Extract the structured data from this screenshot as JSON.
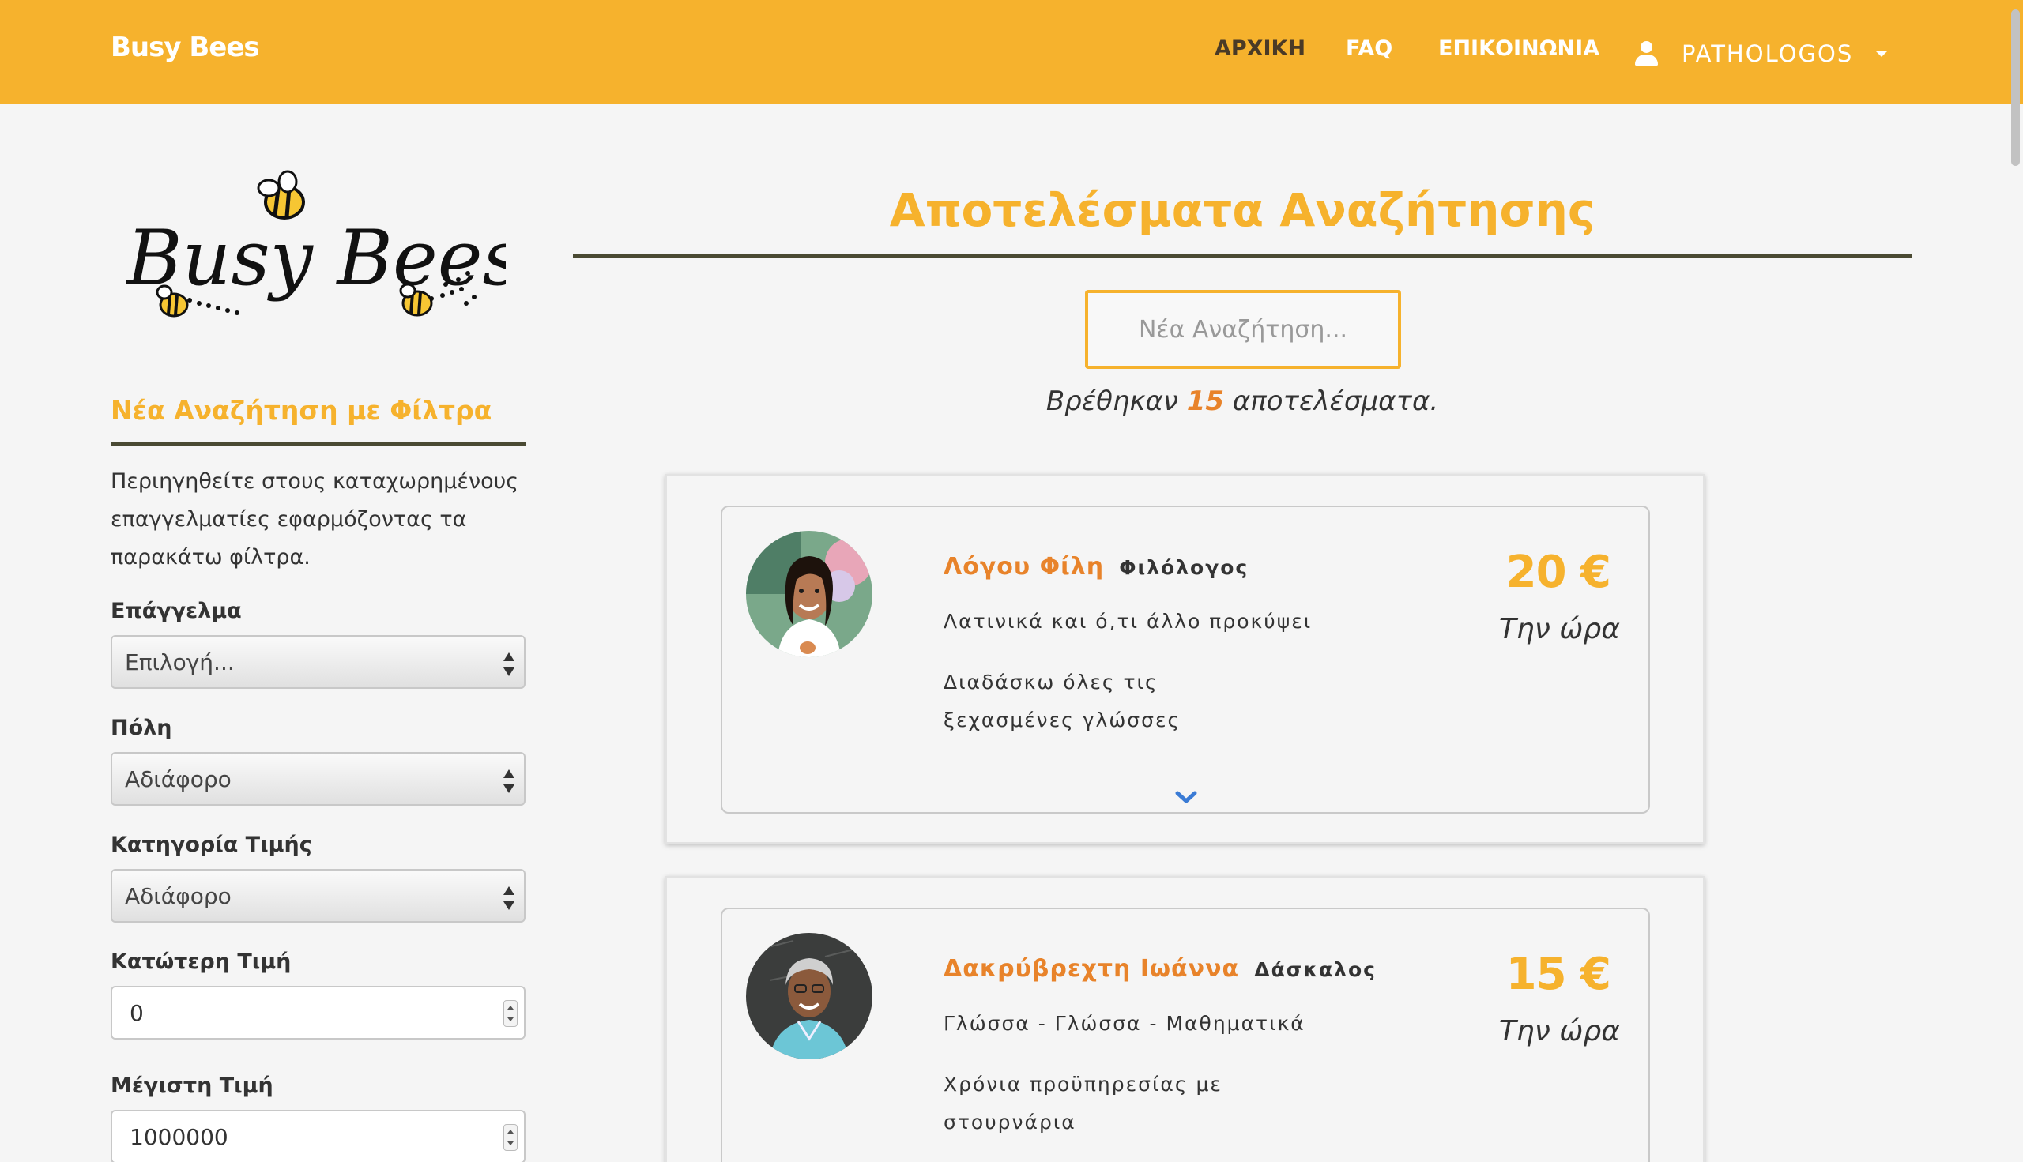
{
  "navbar": {
    "brand": "Busy Bees",
    "links": [
      {
        "label": "ΑΡΧΙΚΗ",
        "active": true
      },
      {
        "label": "FAQ",
        "active": false
      },
      {
        "label": "ΕΠΙΚΟΙΝΩΝΙΑ",
        "active": false
      }
    ],
    "user": {
      "icon": "user-icon",
      "name": "PATHOLOGOS",
      "caret": "caret-down-icon"
    }
  },
  "logo": {
    "text": "Busy Bees"
  },
  "sidebar": {
    "title": "Νέα Αναζήτηση με Φίλτρα",
    "description": "Περιηγηθείτε στους καταχωρημένους επαγγελματίες εφαρμόζοντας τα παρακάτω φίλτρα.",
    "filters": {
      "profession": {
        "label": "Επάγγελμα",
        "value": "Επιλογή..."
      },
      "city": {
        "label": "Πόλη",
        "value": "Αδιάφορο"
      },
      "price_category": {
        "label": "Κατηγορία Τιμής",
        "value": "Αδιάφορο"
      },
      "min_price": {
        "label": "Κατώτερη Τιμή",
        "value": "0"
      },
      "max_price": {
        "label": "Μέγιστη Τιμή",
        "value": "1000000"
      }
    }
  },
  "main": {
    "title": "Αποτελέσματα Αναζήτησης",
    "search_placeholder": "Νέα Αναζήτηση...",
    "results_prefix": "Βρέθηκαν",
    "results_count": "15",
    "results_suffix": "αποτελέσματα."
  },
  "results": [
    {
      "name": "Λόγου Φίλη",
      "profession": "Φιλόλογος",
      "subjects": "Λατινικά και ό,τι άλλο προκύψει",
      "description": "Διαδάσκω όλες τις ξεχασμένες γλώσσες",
      "price": "20 €",
      "price_unit": "Την ώρα"
    },
    {
      "name": "Δακρύβρεχτη Ιωάννα",
      "profession": "Δάσκαλος",
      "subjects": "Γλώσσα - Γλώσσα - Μαθηματικά",
      "description": "Χρόνια προϋπηρεσίας με στουρνάρια",
      "price": "15 €",
      "price_unit": "Την ώρα"
    }
  ],
  "colors": {
    "brand": "#f6b22d",
    "accent_orange": "#e8832a",
    "rule": "#4a4a33",
    "background": "#f5f5f5",
    "expand_icon": "#3a7bd5"
  }
}
